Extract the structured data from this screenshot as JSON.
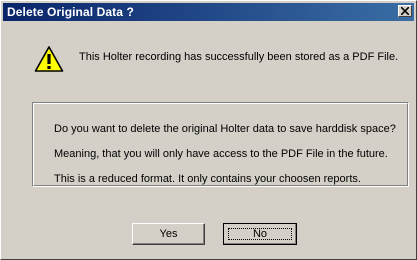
{
  "dialog": {
    "title": "Delete Original Data ?",
    "close_icon": "close-icon",
    "warning_icon": "warning-icon",
    "message": "This Holter recording has successfully been stored as a PDF File.",
    "question_lines": [
      "Do you want to delete the original Holter data to save harddisk space?",
      "Meaning, that you will only have access to the PDF File in the future.",
      "This is a reduced format. It only contains your choosen reports."
    ],
    "buttons": {
      "yes": "Yes",
      "no": "No"
    },
    "colors": {
      "titlebar_start": "#0a246a",
      "titlebar_end": "#3a6ea5",
      "face": "#d4d0c8",
      "warning_yellow": "#ffff00"
    }
  }
}
